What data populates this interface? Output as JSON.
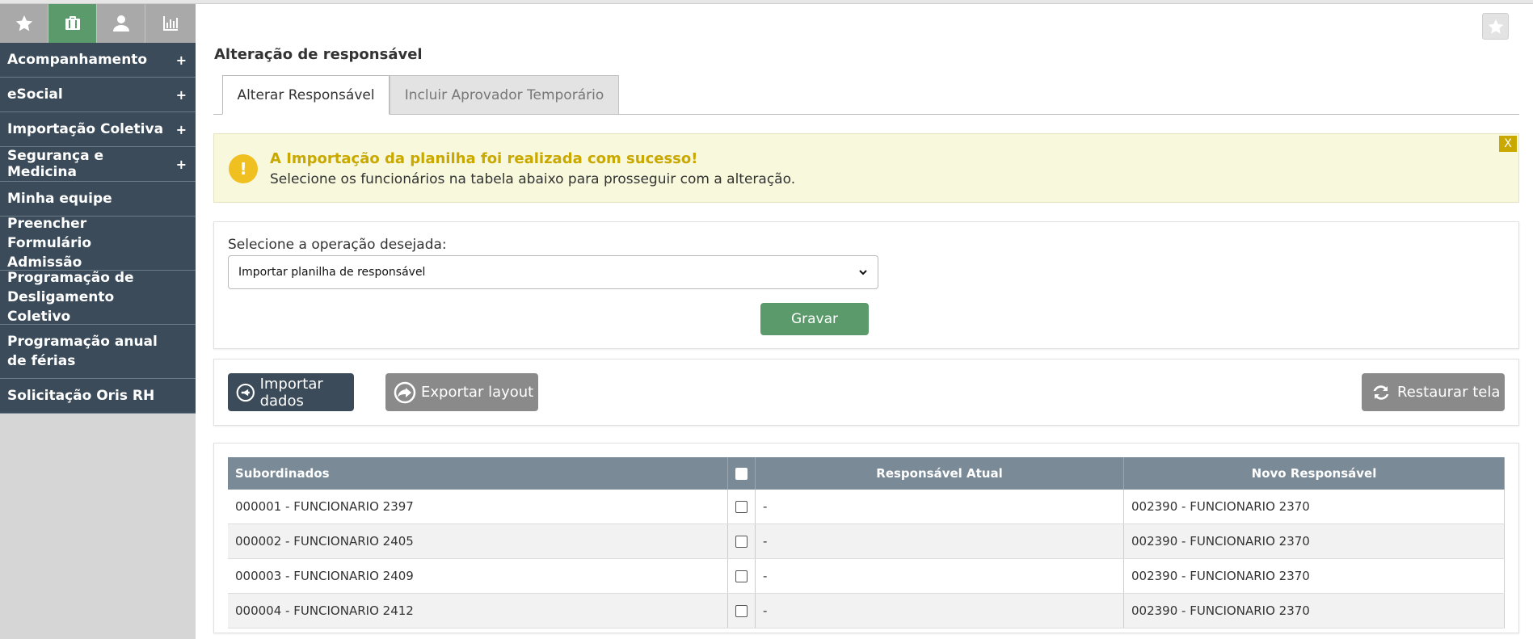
{
  "sidebar": {
    "icon_tabs": [
      {
        "icon": "star-icon",
        "active": false
      },
      {
        "icon": "briefcase-icon",
        "active": true
      },
      {
        "icon": "user-icon",
        "active": false
      },
      {
        "icon": "bar-chart-icon",
        "active": false
      }
    ],
    "items": [
      {
        "label": "Acompanhamento",
        "expand": "+"
      },
      {
        "label": "eSocial",
        "expand": "+"
      },
      {
        "label": "Importação Coletiva",
        "expand": "+"
      },
      {
        "label": "Segurança e Medicina",
        "expand": "+"
      },
      {
        "label": "Minha equipe"
      },
      {
        "label": "Preencher Formulário Admissão"
      },
      {
        "label": "Programação de Desligamento Coletivo"
      },
      {
        "label": "Programação anual de férias"
      },
      {
        "label": "Solicitação Oris RH"
      }
    ]
  },
  "page": {
    "title": "Alteração de responsável",
    "favorite_icon": "star-icon"
  },
  "tabs": [
    {
      "label": "Alterar Responsável",
      "active": true
    },
    {
      "label": "Incluir Aprovador Temporário",
      "active": false
    }
  ],
  "alert": {
    "icon": "!",
    "title": "A Importação da planilha foi realizada com sucesso!",
    "text": "Selecione os funcionários na tabela abaixo para prosseguir com a alteração.",
    "close": "X"
  },
  "operation": {
    "label": "Selecione a operação desejada:",
    "selected": "Importar planilha de responsável",
    "save_label": "Gravar"
  },
  "actions": {
    "import_label": "Importar dados",
    "export_label": "Exportar layout",
    "restore_label": "Restaurar tela"
  },
  "table": {
    "headers": {
      "subordinates": "Subordinados",
      "current": "Responsável Atual",
      "new": "Novo Responsável"
    },
    "rows": [
      {
        "subordinate": "000001 - FUNCIONARIO 2397",
        "current": "-",
        "new": "002390 - FUNCIONARIO 2370"
      },
      {
        "subordinate": "000002 - FUNCIONARIO 2405",
        "current": "-",
        "new": "002390 - FUNCIONARIO 2370"
      },
      {
        "subordinate": "000003 - FUNCIONARIO 2409",
        "current": "-",
        "new": "002390 - FUNCIONARIO 2370"
      },
      {
        "subordinate": "000004 - FUNCIONARIO 2412",
        "current": "-",
        "new": "002390 - FUNCIONARIO 2370"
      }
    ]
  },
  "colors": {
    "sidebar_menu": "#3b4b59",
    "accent_green": "#5b9a6a",
    "alert_title": "#c9a800",
    "table_header": "#7a8a97"
  }
}
